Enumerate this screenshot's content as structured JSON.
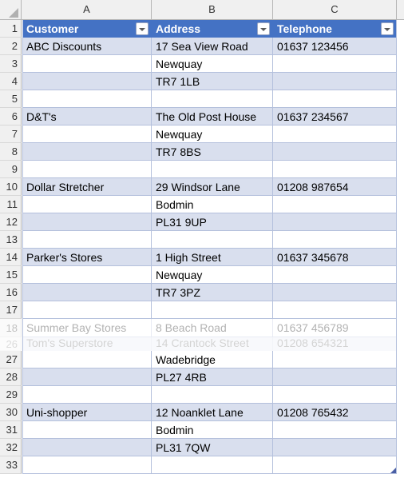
{
  "app": {
    "kind": "spreadsheet-grid",
    "select_all_icon": "select-all-triangle",
    "filter_icon": "filter-dropdown-arrow",
    "resize_icon": "table-resize-handle"
  },
  "colors": {
    "header_fill": "#4472C4",
    "header_text": "#FFFFFF",
    "band_fill": "#D9DFEE",
    "plain_fill": "#FFFFFF",
    "grid_line": "#B4C0DC",
    "gutter_fill": "#F0F0F0",
    "gutter_text": "#333333",
    "resize_handle": "#4A5FA5"
  },
  "columns": [
    {
      "letter": "A",
      "header": "Customer"
    },
    {
      "letter": "B",
      "header": "Address"
    },
    {
      "letter": "C",
      "header": "Telephone"
    }
  ],
  "rows": [
    {
      "n": "1",
      "kind": "header",
      "a": "Customer",
      "b": "Address",
      "c": "Telephone"
    },
    {
      "n": "2",
      "kind": "band",
      "a": "ABC Discounts",
      "b": "17 Sea View Road",
      "c": "01637 123456"
    },
    {
      "n": "3",
      "kind": "plain",
      "a": "",
      "b": "Newquay",
      "c": ""
    },
    {
      "n": "4",
      "kind": "band",
      "a": "",
      "b": "TR7 1LB",
      "c": ""
    },
    {
      "n": "5",
      "kind": "plain",
      "a": "",
      "b": "",
      "c": ""
    },
    {
      "n": "6",
      "kind": "band",
      "a": "D&T's",
      "b": "The Old Post House",
      "c": "01637 234567"
    },
    {
      "n": "7",
      "kind": "plain",
      "a": "",
      "b": "Newquay",
      "c": ""
    },
    {
      "n": "8",
      "kind": "band",
      "a": "",
      "b": "TR7 8BS",
      "c": ""
    },
    {
      "n": "9",
      "kind": "plain",
      "a": "",
      "b": "",
      "c": ""
    },
    {
      "n": "10",
      "kind": "band",
      "a": "Dollar Stretcher",
      "b": "29 Windsor Lane",
      "c": "01208 987654"
    },
    {
      "n": "11",
      "kind": "plain",
      "a": "",
      "b": "Bodmin",
      "c": ""
    },
    {
      "n": "12",
      "kind": "band",
      "a": "",
      "b": "PL31 9UP",
      "c": ""
    },
    {
      "n": "13",
      "kind": "plain",
      "a": "",
      "b": "",
      "c": ""
    },
    {
      "n": "14",
      "kind": "band",
      "a": "Parker's Stores",
      "b": "1 High Street",
      "c": "01637 345678"
    },
    {
      "n": "15",
      "kind": "plain",
      "a": "",
      "b": "Newquay",
      "c": ""
    },
    {
      "n": "16",
      "kind": "band",
      "a": "",
      "b": "TR7 3PZ",
      "c": ""
    },
    {
      "n": "17",
      "kind": "plain",
      "a": "",
      "b": "",
      "c": ""
    },
    {
      "n": "18",
      "kind": "ghost",
      "a": "Summer Bay Stores",
      "b": "8 Beach Road",
      "c": "01637 456789"
    },
    {
      "n": "26",
      "kind": "ghost-clipped",
      "a": "Tom's Superstore",
      "b": "14 Crantock Street",
      "c": "01208 654321"
    },
    {
      "n": "27",
      "kind": "plain",
      "a": "",
      "b": "Wadebridge",
      "c": ""
    },
    {
      "n": "28",
      "kind": "band",
      "a": "",
      "b": "PL27 4RB",
      "c": ""
    },
    {
      "n": "29",
      "kind": "plain",
      "a": "",
      "b": "",
      "c": ""
    },
    {
      "n": "30",
      "kind": "band",
      "a": "Uni-shopper",
      "b": "12 Noanklet Lane",
      "c": "01208 765432"
    },
    {
      "n": "31",
      "kind": "plain",
      "a": "",
      "b": "Bodmin",
      "c": ""
    },
    {
      "n": "32",
      "kind": "band",
      "a": "",
      "b": "PL31 7QW",
      "c": ""
    },
    {
      "n": "33",
      "kind": "plain",
      "a": "",
      "b": "",
      "c": ""
    }
  ]
}
